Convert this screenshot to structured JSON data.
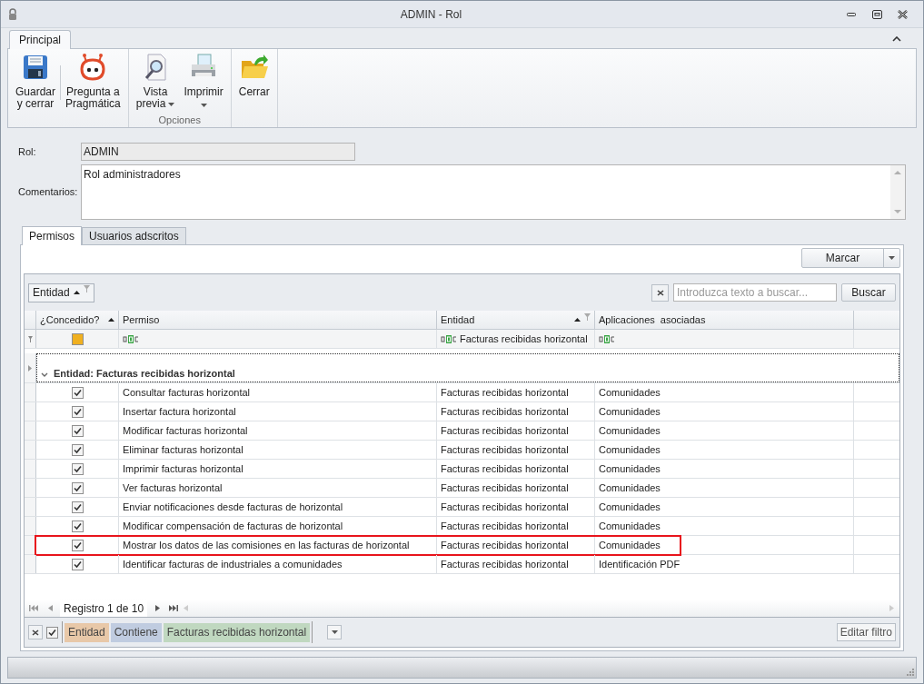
{
  "window": {
    "title": "ADMIN - Rol"
  },
  "ribbon": {
    "tabs": [
      {
        "label": "Principal",
        "selected": true
      }
    ],
    "groups": [
      {
        "buttons": [
          {
            "kind": "save",
            "lines": [
              "Guardar",
              "y cerrar"
            ],
            "dropdown": false
          },
          {
            "kind": "robot",
            "lines": [
              "Pregunta a",
              "Pragmática"
            ],
            "dropdown": false
          }
        ]
      },
      {
        "label": "Opciones",
        "buttons": [
          {
            "kind": "preview",
            "lines": [
              "Vista",
              "previa"
            ],
            "dropdown": true
          },
          {
            "kind": "print",
            "lines": [
              "Imprimir"
            ],
            "dropdown": true
          }
        ]
      },
      {
        "buttons": [
          {
            "kind": "close",
            "lines": [
              "Cerrar"
            ],
            "dropdown": false
          }
        ]
      }
    ]
  },
  "form": {
    "rol_label": "Rol:",
    "rol_value": "ADMIN",
    "comments_label": "Comentarios:",
    "comments_value": "Rol administradores"
  },
  "tabs": [
    {
      "label": "Permisos",
      "selected": true
    },
    {
      "label": "Usuarios adscritos",
      "selected": false
    }
  ],
  "mark_button": "Marcar",
  "grid": {
    "group_chip": "Entidad",
    "search_placeholder": "Introduzca texto a buscar...",
    "search_button": "Buscar",
    "columns": [
      {
        "label": "¿Concedido?",
        "sorted": true,
        "filter": false
      },
      {
        "label": "Permiso",
        "sorted": false,
        "filter": false
      },
      {
        "label": "Entidad",
        "sorted": true,
        "filter": true
      },
      {
        "label": "Aplicaciones  asociadas",
        "sorted": false,
        "filter": false
      }
    ],
    "filter_row": {
      "concedido_indeterminate": true,
      "entidad": "Facturas recibidas horizontal"
    },
    "group_row": "Entidad: Facturas recibidas horizontal",
    "rows": [
      {
        "checked": true,
        "permiso": "Consultar facturas horizontal",
        "entidad": "Facturas recibidas horizontal",
        "aplicaciones": "Comunidades",
        "highlighted": false
      },
      {
        "checked": true,
        "permiso": "Insertar factura horizontal",
        "entidad": "Facturas recibidas horizontal",
        "aplicaciones": "Comunidades",
        "highlighted": false
      },
      {
        "checked": true,
        "permiso": "Modificar facturas horizontal",
        "entidad": "Facturas recibidas horizontal",
        "aplicaciones": "Comunidades",
        "highlighted": false
      },
      {
        "checked": true,
        "permiso": "Eliminar  facturas horizontal",
        "entidad": "Facturas recibidas horizontal",
        "aplicaciones": "Comunidades",
        "highlighted": false
      },
      {
        "checked": true,
        "permiso": "Imprimir facturas horizontal",
        "entidad": "Facturas recibidas horizontal",
        "aplicaciones": "Comunidades",
        "highlighted": false
      },
      {
        "checked": true,
        "permiso": "Ver  facturas horizontal",
        "entidad": "Facturas recibidas horizontal",
        "aplicaciones": "Comunidades",
        "highlighted": false
      },
      {
        "checked": true,
        "permiso": "Enviar notificaciones desde facturas de horizontal",
        "entidad": "Facturas recibidas horizontal",
        "aplicaciones": "Comunidades",
        "highlighted": false
      },
      {
        "checked": true,
        "permiso": "Modificar compensación de facturas de horizontal",
        "entidad": "Facturas recibidas horizontal",
        "aplicaciones": "Comunidades",
        "highlighted": false
      },
      {
        "checked": true,
        "permiso": "Mostrar los datos de las comisiones en las facturas de horizontal",
        "entidad": "Facturas recibidas horizontal",
        "aplicaciones": "Comunidades",
        "highlighted": true
      },
      {
        "checked": true,
        "permiso": "Identificar facturas de industriales a comunidades",
        "entidad": "Facturas recibidas horizontal",
        "aplicaciones": "Identificación PDF",
        "highlighted": false
      }
    ],
    "navigator": "Registro 1 de 10",
    "filter": {
      "enabled": true,
      "chips": [
        {
          "text": "Entidad",
          "color": "#e8c8a8"
        },
        {
          "text": "Contiene",
          "color": "#c0cce0"
        },
        {
          "text": "Facturas recibidas horizontal",
          "color": "#c0d8c0"
        }
      ],
      "edit_button": "Editar filtro"
    }
  }
}
